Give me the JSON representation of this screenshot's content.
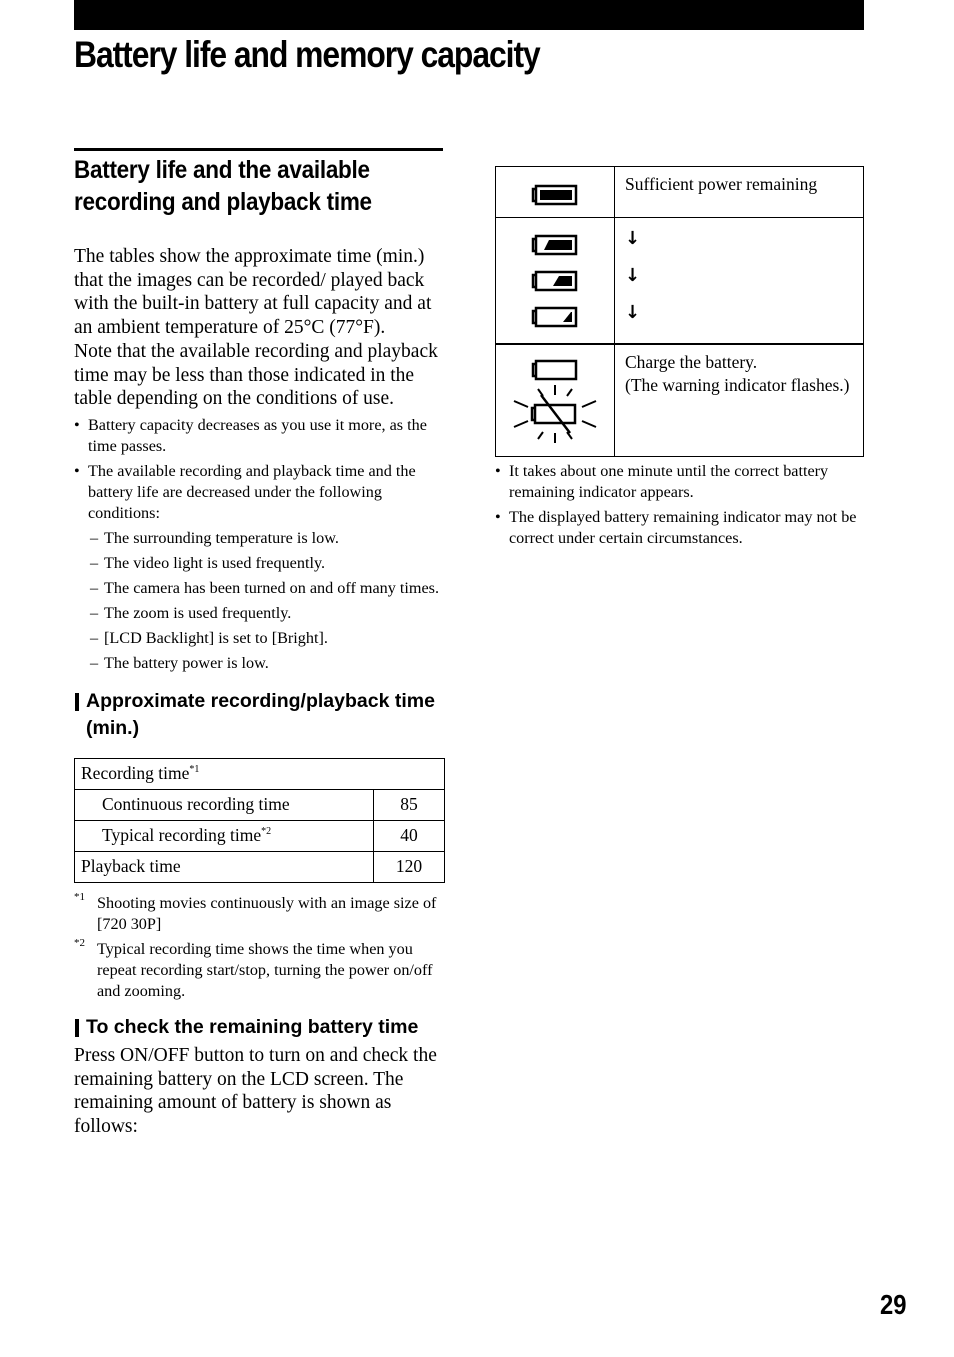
{
  "page": {
    "title": "Battery life and memory capacity",
    "page_number": "29"
  },
  "left": {
    "section_title": "Battery life and the available recording and playback time",
    "intro": "The tables show the approximate time (min.) that the images can be recorded/ played back with the built-in battery at full capacity and at an ambient temperature of 25°C (77°F).",
    "note": "Note that the available recording and playback time may be less than those indicated in the table depending on the conditions of use.",
    "bullets": [
      "Battery capacity decreases as you use it more, as the time passes.",
      "The available recording and playback time and the battery life are decreased under the following conditions:"
    ],
    "conditions": [
      "The surrounding temperature is low.",
      "The video light is used frequently.",
      "The camera has been turned on and off many times.",
      "The zoom is used frequently.",
      "[LCD Backlight] is set to [Bright].",
      "The battery power is low."
    ],
    "subhead_recording": "Approximate recording/playback time (min.)",
    "table": {
      "recording_header": "Recording time",
      "recording_header_note": "*1",
      "rows": [
        {
          "label": "Continuous recording time",
          "note": "",
          "value": "85"
        },
        {
          "label": "Typical recording time",
          "note": "*2",
          "value": "40"
        },
        {
          "label": "Playback time",
          "note": "",
          "value": "120"
        }
      ]
    },
    "footnotes": [
      {
        "mark": "*1",
        "text": "Shooting movies continuously with an image size of [720 30P]"
      },
      {
        "mark": "*2",
        "text": "Typical recording time shows the time when you repeat recording start/stop, turning the power on/off and zooming."
      }
    ],
    "subhead_check": "To check the remaining battery time",
    "check_text": "Press ON/OFF button to turn on and check the remaining battery on the LCD screen. The remaining amount of battery is shown as follows:"
  },
  "right": {
    "battery_table": [
      {
        "icons": [
          "battery-full-icon"
        ],
        "text": "Sufficient power remaining"
      },
      {
        "icons": [
          "battery-three-quarter-icon",
          "battery-half-icon",
          "battery-quarter-icon"
        ],
        "arrows": [
          "↓",
          "↓",
          "↓"
        ]
      },
      {
        "icons": [
          "battery-empty-icon",
          "battery-empty-flashing-icon"
        ],
        "text_lines": [
          "Charge the battery.",
          "(The warning indicator flashes.)"
        ]
      }
    ],
    "bullets": [
      "It takes about one minute until the correct battery remaining indicator appears.",
      "The displayed battery remaining indicator may not be correct under certain circumstances."
    ]
  },
  "symbols": {
    "bullet": "•",
    "dash": "–"
  }
}
